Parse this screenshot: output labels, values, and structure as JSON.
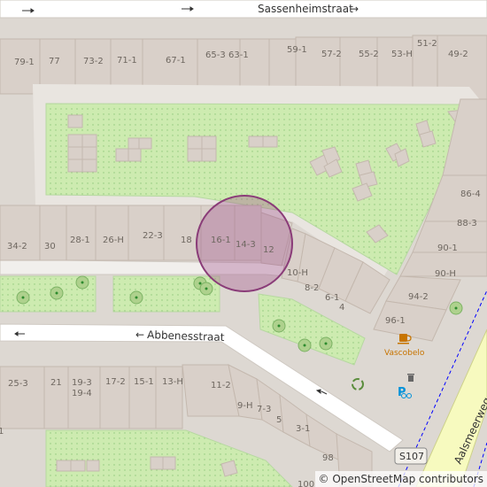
{
  "streets": {
    "top": "Sassenheimstraat",
    "middle": "Abbenesstraat",
    "right": "Aalsmeerweg"
  },
  "route_shield": "S107",
  "cafe": {
    "name": "Vascobelo",
    "icon": "coffee-cup-icon",
    "color": "#c77400"
  },
  "icons": {
    "recycling": "recycling-icon",
    "bicycle_parking": "bicycle-parking-icon",
    "waste_basket": "waste-basket-icon"
  },
  "attribution": "© OpenStreetMap contributors",
  "highlight_color": "#a0508c",
  "house_numbers": {
    "n79_1": "79-1",
    "n77": "77",
    "n73_2": "73-2",
    "n71_1": "71-1",
    "n67_1": "67-1",
    "n65_3": "65-3",
    "n63_1": "63-1",
    "n59_1": "59-1",
    "n57_2": "57-2",
    "n55_2": "55-2",
    "n53_H": "53-H",
    "n51_2": "51-2",
    "n49_2": "49-2",
    "n86_4": "86-4",
    "n88_3": "88-3",
    "n90_1": "90-1",
    "n90_H": "90-H",
    "n94_2": "94-2",
    "n96_1": "96-1",
    "n34_2": "34-2",
    "n30": "30",
    "n28_1": "28-1",
    "n26_H": "26-H",
    "n22_3": "22-3",
    "n18": "18",
    "n16_1": "16-1",
    "n14_3": "14-3",
    "n12": "12",
    "n10_H": "10-H",
    "n8_2": "8-2",
    "n6_1": "6-1",
    "n4": "4",
    "n25_3": "25-3",
    "n21": "21",
    "n19_3": "19-3",
    "n19_4": "19-4",
    "n17_2": "17-2",
    "n15_1": "15-1",
    "n13_H": "13-H",
    "n11_2": "11-2",
    "n9_H": "9-H",
    "n7_3": "7-3",
    "n5": "5",
    "n3_1": "3-1",
    "n98": "98",
    "n100": "100",
    "n1": "1"
  }
}
